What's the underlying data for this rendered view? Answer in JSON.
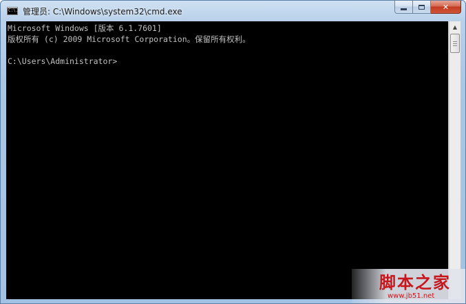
{
  "window": {
    "title": "管理员: C:\\Windows\\system32\\cmd.exe",
    "icon": "cmd-icon",
    "app_icon_text": "C:\\.",
    "close_glyph": "✕"
  },
  "console": {
    "lines": [
      "Microsoft Windows [版本 6.1.7601]",
      "版权所有 (c) 2009 Microsoft Corporation。保留所有权利。",
      "",
      "C:\\Users\\Administrator>"
    ],
    "background": "#000000",
    "foreground": "#c0c0c0"
  },
  "watermark": {
    "logo": "脚本之家",
    "url": "www.jb51.net"
  }
}
